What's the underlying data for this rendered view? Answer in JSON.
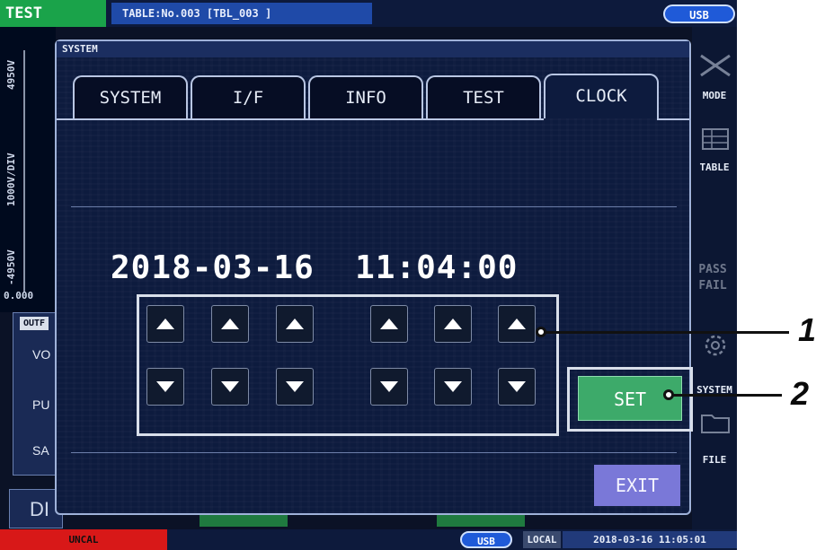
{
  "topbar": {
    "mode": "TEST",
    "table": "TABLE:No.003 [TBL_003         ]",
    "usb": "USB"
  },
  "graph": {
    "y_top": "4950V",
    "y_div": "1000V/DIV",
    "y_bottom": "-4950V",
    "x_start": "0.000"
  },
  "bg_panel": {
    "outf": "OUTF",
    "items": [
      "VO",
      "PU",
      "SA"
    ],
    "di": "DI"
  },
  "rightbar": {
    "items": [
      "MODE",
      "TABLE",
      "PASS FAIL",
      "SYSTEM",
      "FILE"
    ]
  },
  "bottombar": {
    "status": "UNCAL",
    "usb": "USB",
    "local": "LOCAL",
    "clock": "2018-03-16 11:05:01"
  },
  "dialog": {
    "title": "SYSTEM",
    "tabs": [
      "SYSTEM",
      "I/F",
      "INFO",
      "TEST",
      "CLOCK"
    ],
    "active_tab": "CLOCK",
    "datetime": "2018-03-16  11:04:00",
    "set_label": "SET",
    "exit_label": "EXIT"
  },
  "callouts": [
    "1",
    "2"
  ],
  "colors": {
    "set_green": "#3daa6a",
    "exit_purple": "#7a78d8",
    "test_green": "#1aa34a",
    "uncal_red": "#d81818"
  }
}
